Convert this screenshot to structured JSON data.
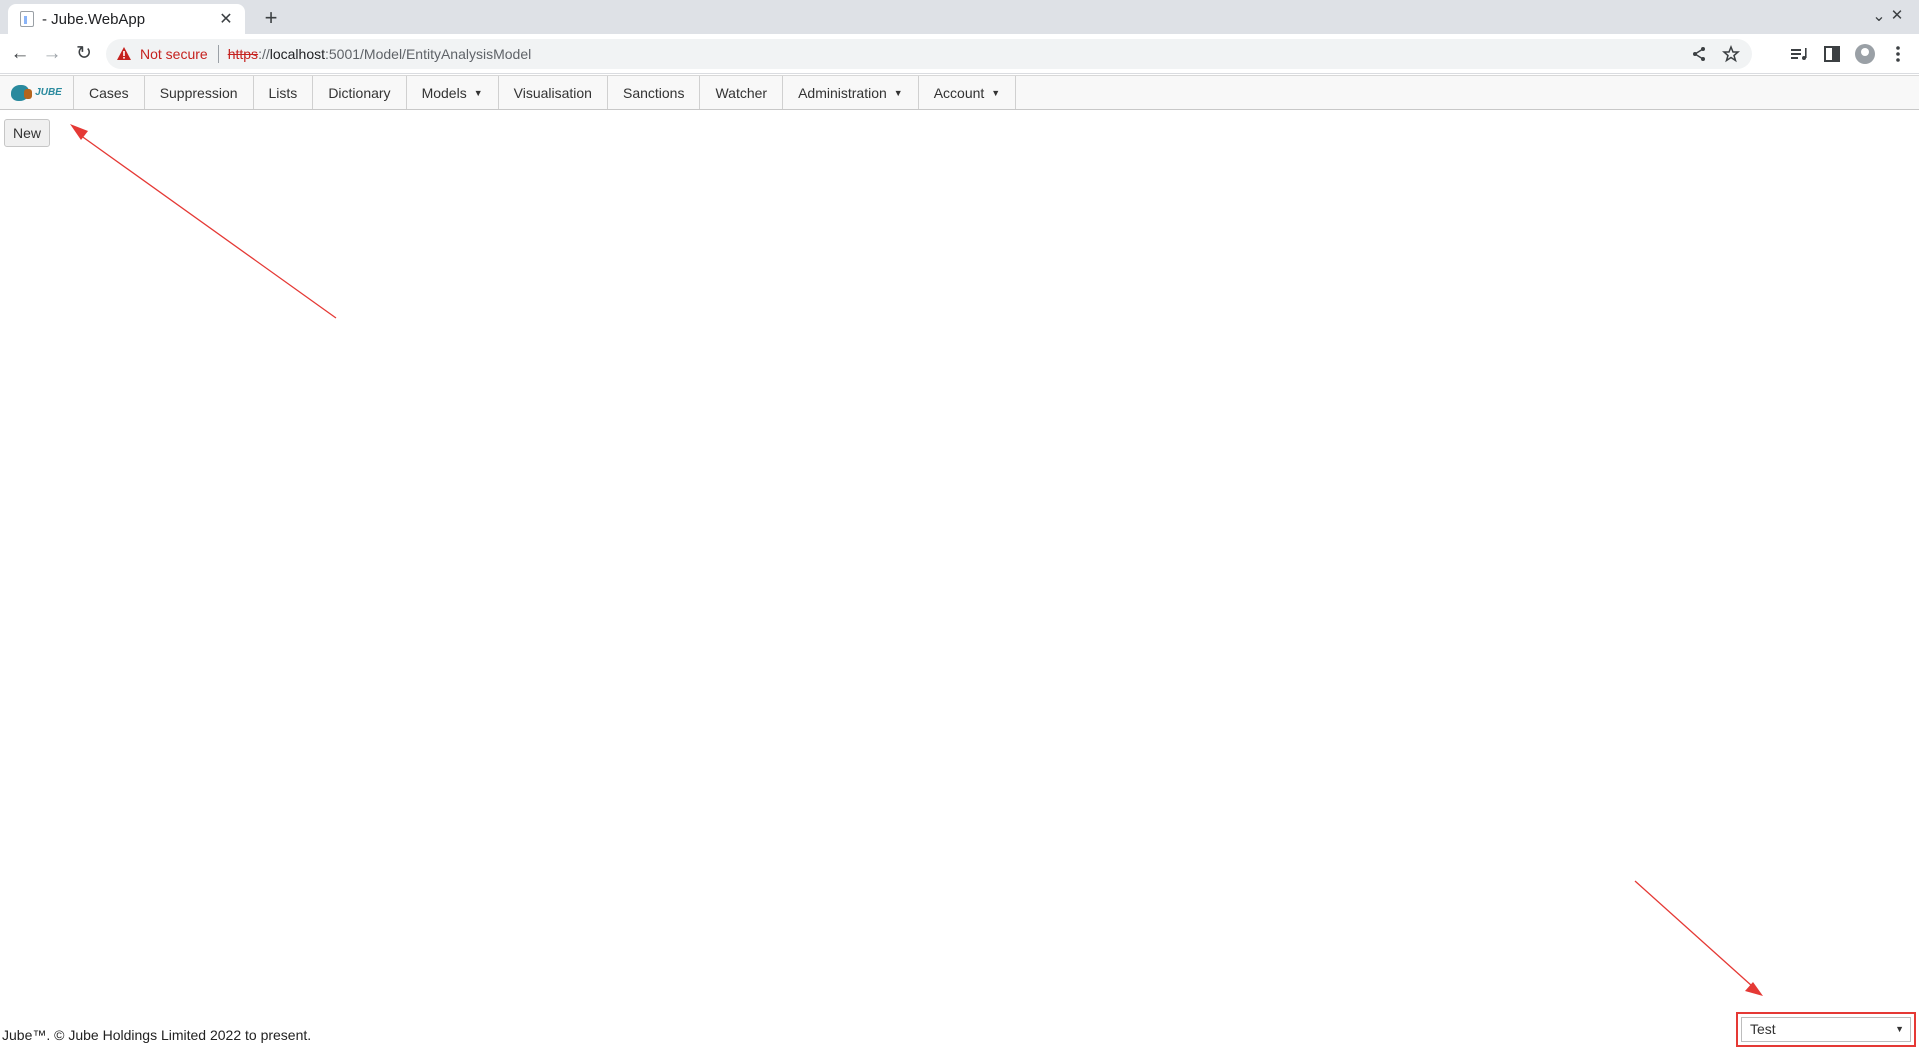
{
  "browser": {
    "tab_title": "- Jube.WebApp",
    "new_tab": "+",
    "tab_close": "✕",
    "window": {
      "minimize_glyph": "⌄",
      "close_glyph": "✕"
    },
    "nav": {
      "back": "←",
      "forward": "→",
      "reload": "↻"
    },
    "security_label": "Not secure",
    "url": {
      "scheme": "https",
      "sep": "://",
      "host": "localhost",
      "rest": ":5001/Model/EntityAnalysisModel"
    },
    "icons": [
      "share-icon",
      "bookmark-star-icon",
      "media-icon",
      "side-panel-icon",
      "profile-icon",
      "kebab-menu-icon"
    ]
  },
  "app": {
    "logo_text": "JUBE",
    "menu": [
      {
        "label": "Cases",
        "dropdown": false
      },
      {
        "label": "Suppression",
        "dropdown": false
      },
      {
        "label": "Lists",
        "dropdown": false
      },
      {
        "label": "Dictionary",
        "dropdown": false
      },
      {
        "label": "Models",
        "dropdown": true
      },
      {
        "label": "Visualisation",
        "dropdown": false
      },
      {
        "label": "Sanctions",
        "dropdown": false
      },
      {
        "label": "Watcher",
        "dropdown": false
      },
      {
        "label": "Administration",
        "dropdown": true
      },
      {
        "label": "Account",
        "dropdown": true
      }
    ],
    "new_button": "New",
    "footer": "Jube™. © Jube Holdings Limited 2022 to present.",
    "model_select": {
      "value": "Test"
    }
  },
  "colors": {
    "annotation": "#e53935",
    "not_secure": "#c5221f",
    "logo": "#2a8a9e"
  }
}
